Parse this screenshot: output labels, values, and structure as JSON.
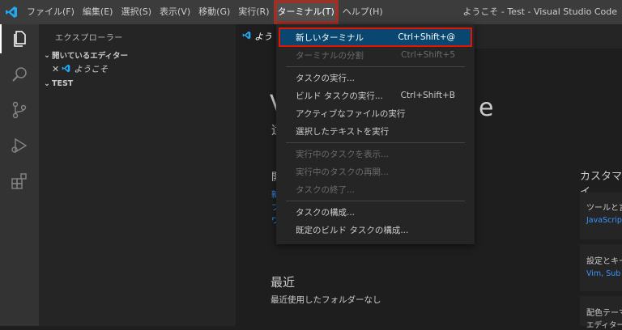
{
  "menubar": {
    "items": [
      "ファイル(F)",
      "編集(E)",
      "選択(S)",
      "表示(V)",
      "移動(G)",
      "実行(R)",
      "ターミナル(T)",
      "ヘルプ(H)"
    ],
    "window_title": "ようこそ - Test - Visual Studio Code"
  },
  "sidebar": {
    "title": "エクスプローラー",
    "open_editors": "開いているエディター",
    "open_file": "ようこそ",
    "folder": "TEST"
  },
  "editor": {
    "tab_label": "よう",
    "welcome_title_partial": "V",
    "welcome_title_end": "e",
    "welcome_sub_partial": "适",
    "start_partial": "開",
    "start_links": [
      "新",
      "フ",
      "ワ"
    ],
    "recent_heading": "最近",
    "recent_empty": "最近使用したフォルダーなし",
    "customize_heading": "カスタマイ",
    "cards": [
      {
        "title": "ツールと言",
        "link": "JavaScrip"
      },
      {
        "title": "設定とキー",
        "link": "Vim, Sub"
      },
      {
        "title": "配色テーマ",
        "link": "エディター"
      }
    ]
  },
  "terminal_menu": {
    "groups": [
      [
        {
          "label": "新しいターミナル",
          "shortcut": "Ctrl+Shift+@",
          "enabled": true
        },
        {
          "label": "ターミナルの分割",
          "shortcut": "Ctrl+Shift+5",
          "enabled": false
        }
      ],
      [
        {
          "label": "タスクの実行...",
          "shortcut": "",
          "enabled": true
        },
        {
          "label": "ビルド タスクの実行...",
          "shortcut": "Ctrl+Shift+B",
          "enabled": true
        },
        {
          "label": "アクティブなファイルの実行",
          "shortcut": "",
          "enabled": true
        },
        {
          "label": "選択したテキストを実行",
          "shortcut": "",
          "enabled": true
        }
      ],
      [
        {
          "label": "実行中のタスクを表示...",
          "shortcut": "",
          "enabled": false
        },
        {
          "label": "実行中のタスクの再開...",
          "shortcut": "",
          "enabled": false
        },
        {
          "label": "タスクの終了...",
          "shortcut": "",
          "enabled": false
        }
      ],
      [
        {
          "label": "タスクの構成...",
          "shortcut": "",
          "enabled": true
        },
        {
          "label": "既定のビルド タスクの構成...",
          "shortcut": "",
          "enabled": true
        }
      ]
    ]
  },
  "colors": {
    "accent": "#007acc",
    "highlight": "#094771",
    "callout": "#e51400",
    "link": "#3794ff"
  },
  "icons": {
    "logo": "vscode-logo-icon",
    "activity": [
      "files-icon",
      "search-icon",
      "source-control-icon",
      "run-debug-icon",
      "extensions-icon"
    ]
  }
}
